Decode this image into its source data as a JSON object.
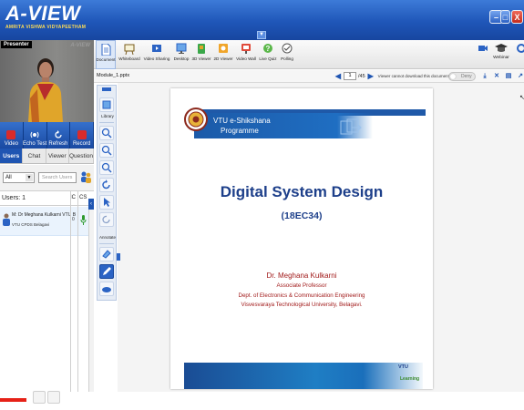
{
  "app": {
    "title": "A-VIEW",
    "subtitle": "AMRITA VISHWA VIDYAPEETHAM"
  },
  "window_controls": {
    "minimize": "–",
    "maximize": "□",
    "close": "X"
  },
  "presenter": {
    "label": "Presenter",
    "watermark": "A-VIEW"
  },
  "media_buttons": [
    {
      "label": "Video"
    },
    {
      "label": "Echo Test"
    },
    {
      "label": "Refresh"
    },
    {
      "label": "Record"
    }
  ],
  "side_tabs": [
    {
      "label": "Users",
      "active": true
    },
    {
      "label": "Chat",
      "active": false
    },
    {
      "label": "Viewer",
      "active": false
    },
    {
      "label": "Question",
      "active": false
    }
  ],
  "filter": {
    "selected": "All",
    "search_placeholder": "Search Users"
  },
  "users_header": {
    "count_label": "Users: 1",
    "ic": "IC",
    "cs": "CS"
  },
  "users": [
    {
      "name": "M: Dr Meghana Kulkarni VTU B",
      "location": "VTU CPDS Belagavi",
      "ic": "0"
    }
  ],
  "toolbar": {
    "tools": [
      {
        "label": "Document",
        "icon": "document-icon",
        "active": true
      },
      {
        "label": "Whiteboard",
        "icon": "whiteboard-icon",
        "active": false
      },
      {
        "label": "Video Sharing",
        "icon": "video-sharing-icon",
        "active": false
      },
      {
        "label": "Desktop",
        "icon": "desktop-icon",
        "active": false
      },
      {
        "label": "3D Viewer",
        "icon": "3d-viewer-icon",
        "active": false
      },
      {
        "label": "2D Viewer",
        "icon": "2d-viewer-icon",
        "active": false
      },
      {
        "label": "Video Wall",
        "icon": "video-wall-icon",
        "active": false
      },
      {
        "label": "Live Quiz",
        "icon": "live-quiz-icon",
        "active": false
      },
      {
        "label": "Polling",
        "icon": "polling-icon",
        "active": false
      }
    ],
    "webinar_label": "Webinar"
  },
  "document_bar": {
    "file_name": "Module_1.pptx",
    "current_page": "1",
    "total_pages": "/45",
    "download_message": "Viewer cannot download this document",
    "toggle_label": "Deny"
  },
  "annotation_tools": {
    "library_label": "Library",
    "annotate_label": "Annotate"
  },
  "slide": {
    "programme_line1": "VTU e-Shikshana",
    "programme_line2": "Programme",
    "title": "Digital System Design",
    "course_code": "(18EC34)",
    "presenter_name": "Dr. Meghana Kulkarni",
    "designation": "Associate Professor",
    "department": "Dept. of Electronics & Communication Engineering",
    "university": "Visvesvaraya Technological University, Belagavi.",
    "footer_logo_top": "VTU",
    "footer_logo_bottom": "Learning"
  },
  "video_progress": 0.05,
  "colors": {
    "header_blue": "#1f56b8",
    "slide_title": "#1d3f8a",
    "slide_presenter_text": "#a11a1a",
    "progress_red": "#e62117"
  }
}
